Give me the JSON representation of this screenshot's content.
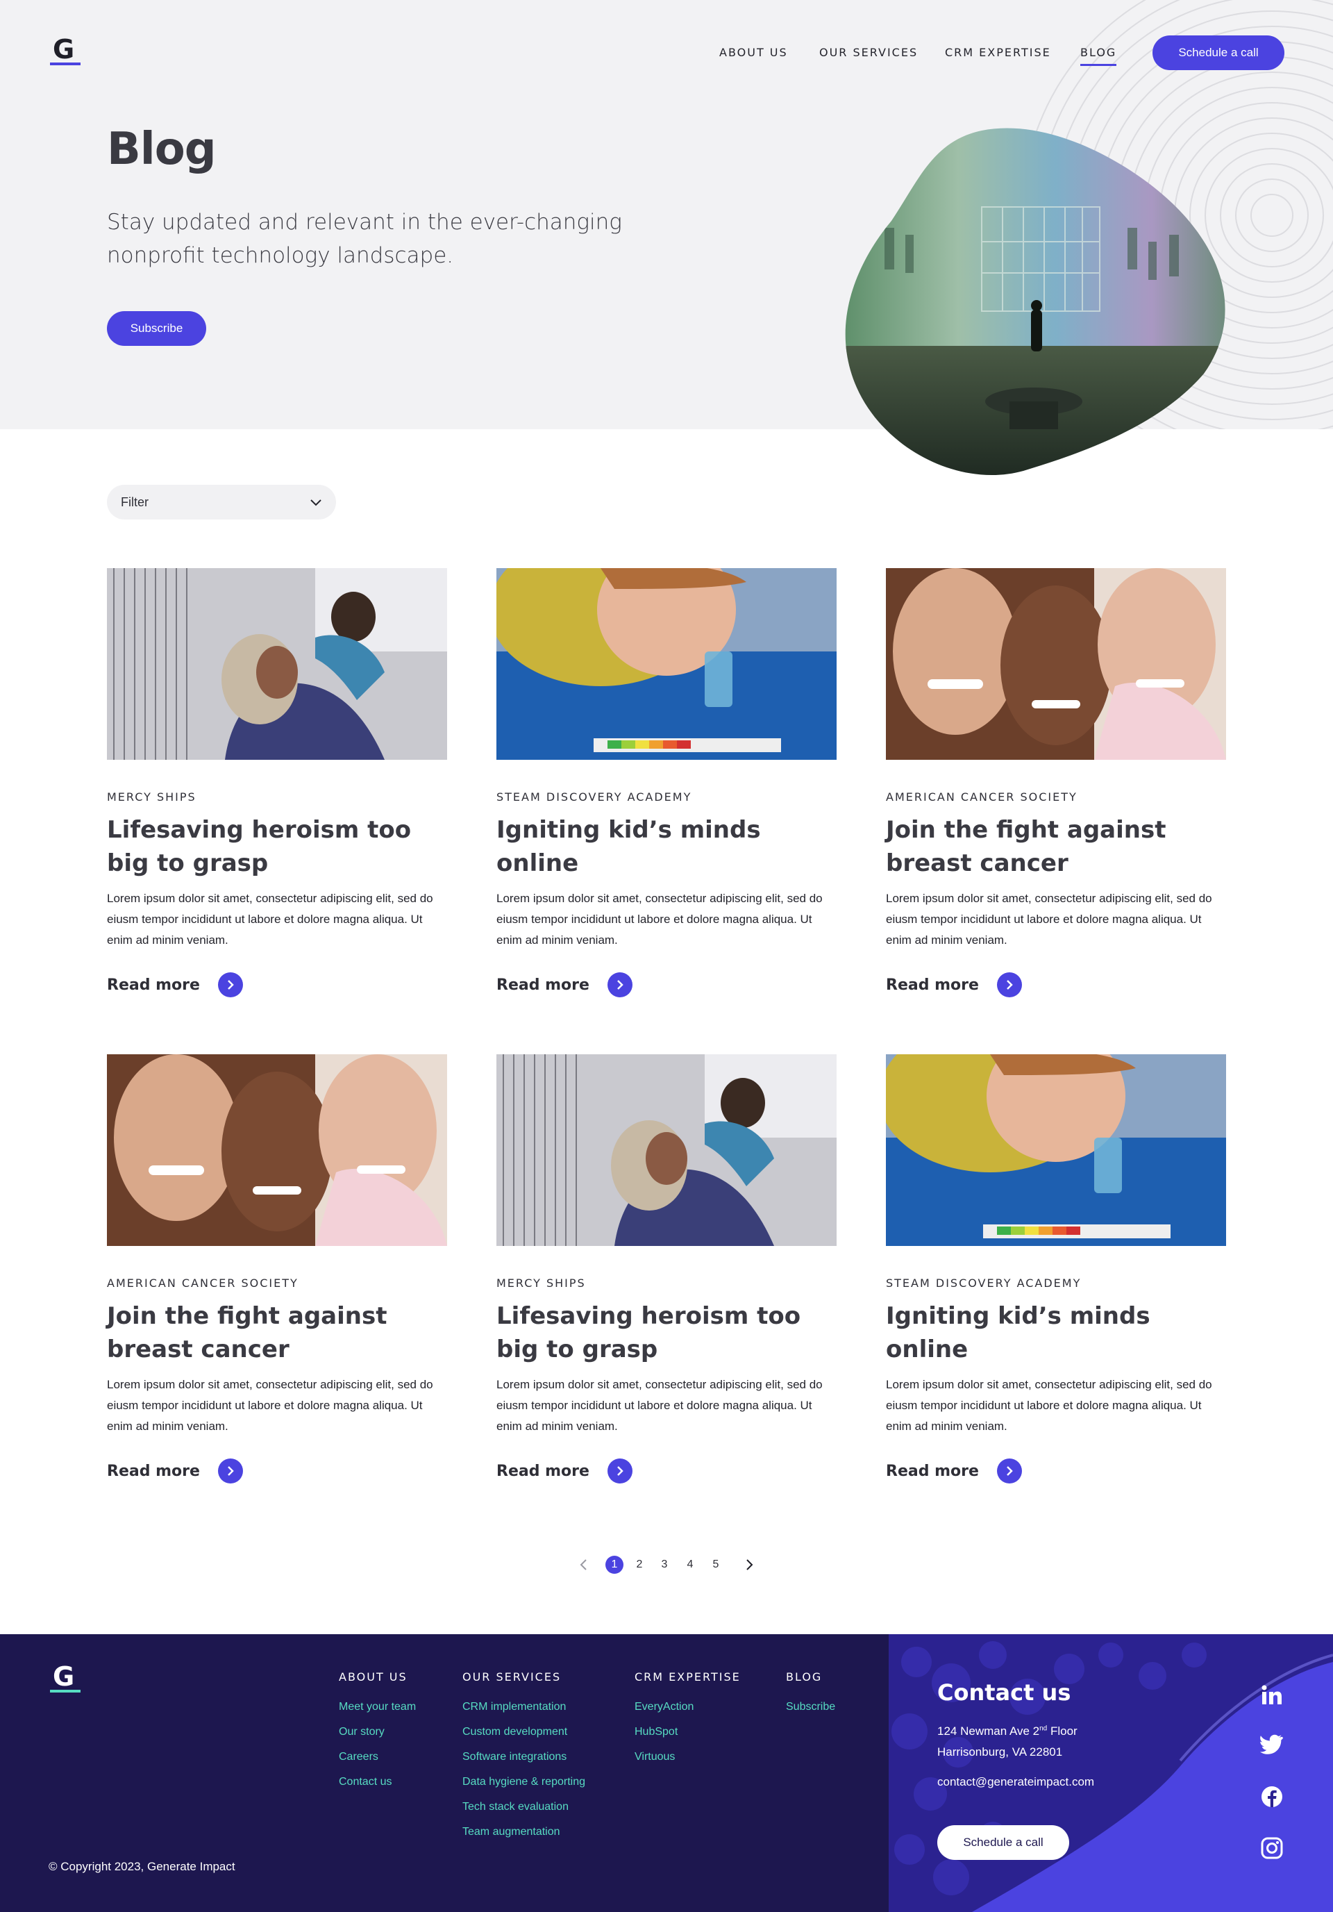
{
  "brand": {
    "logo_letter": "G",
    "accent": "#4b43e0",
    "teal": "#57dcc2",
    "footer_bg": "#1d174f"
  },
  "nav": {
    "items": [
      {
        "label": "ABOUT US"
      },
      {
        "label": "OUR SERVICES"
      },
      {
        "label": "CRM EXPERTISE"
      },
      {
        "label": "BLOG",
        "active": true
      }
    ],
    "cta": "Schedule a call"
  },
  "hero": {
    "title": "Blog",
    "subtitle": "Stay updated and relevant in the ever-changing nonprofit technology landscape.",
    "subscribe": "Subscribe"
  },
  "filter": {
    "label": "Filter"
  },
  "posts": [
    {
      "tag": "MERCY SHIPS",
      "title": "Lifesaving heroism too big to grasp",
      "body": "Lorem ipsum dolor sit amet, consectetur adipiscing elit, sed do eiusm tempor incididunt ut labore et dolore magna aliqua. Ut enim ad minim veniam.",
      "read": "Read more"
    },
    {
      "tag": "STEAM DISCOVERY ACADEMY",
      "title": "Igniting kid’s minds online",
      "body": "Lorem ipsum dolor sit amet, consectetur adipiscing elit, sed do eiusm tempor incididunt ut labore et dolore magna aliqua. Ut enim ad minim veniam.",
      "read": "Read more"
    },
    {
      "tag": "AMERICAN CANCER SOCIETY",
      "title": "Join the fight against breast cancer",
      "body": "Lorem ipsum dolor sit amet, consectetur adipiscing elit, sed do eiusm tempor incididunt ut labore et dolore magna aliqua. Ut enim ad minim veniam.",
      "read": "Read more"
    },
    {
      "tag": "AMERICAN CANCER SOCIETY",
      "title": "Join the fight against breast cancer",
      "body": "Lorem ipsum dolor sit amet, consectetur adipiscing elit, sed do eiusm tempor incididunt ut labore et dolore magna aliqua. Ut enim ad minim veniam.",
      "read": "Read more"
    },
    {
      "tag": "MERCY SHIPS",
      "title": "Lifesaving heroism too big to grasp",
      "body": "Lorem ipsum dolor sit amet, consectetur adipiscing elit, sed do eiusm tempor incididunt ut labore et dolore magna aliqua. Ut enim ad minim veniam.",
      "read": "Read more"
    },
    {
      "tag": "STEAM DISCOVERY ACADEMY",
      "title": "Igniting kid’s minds online",
      "body": "Lorem ipsum dolor sit amet, consectetur adipiscing elit, sed do eiusm tempor incididunt ut labore et dolore magna aliqua. Ut enim ad minim veniam.",
      "read": "Read more"
    }
  ],
  "pagination": {
    "pages": [
      "1",
      "2",
      "3",
      "4",
      "5"
    ],
    "current": "1"
  },
  "footer": {
    "columns": [
      {
        "heading": "ABOUT US",
        "links": [
          "Meet your team",
          "Our story",
          "Careers",
          "Contact us"
        ]
      },
      {
        "heading": "OUR SERVICES",
        "links": [
          "CRM implementation",
          "Custom development",
          "Software integrations",
          "Data hygiene & reporting",
          "Tech stack evaluation",
          "Team augmentation"
        ]
      },
      {
        "heading": "CRM EXPERTISE",
        "links": [
          "EveryAction",
          "HubSpot",
          "Virtuous"
        ]
      },
      {
        "heading": "BLOG",
        "links": [
          "Subscribe"
        ]
      }
    ],
    "copyright": "© Copyright 2023, Generate Impact",
    "contact": {
      "title": "Contact us",
      "address_line1_prefix": "124 Newman Ave 2",
      "address_line1_sup": "nd",
      "address_line1_suffix": " Floor",
      "address_line2": "Harrisonburg, VA 22801",
      "email": "contact@generateimpact.com",
      "cta": "Schedule a call"
    },
    "social": [
      "linkedin-icon",
      "twitter-icon",
      "facebook-icon",
      "instagram-icon"
    ]
  }
}
